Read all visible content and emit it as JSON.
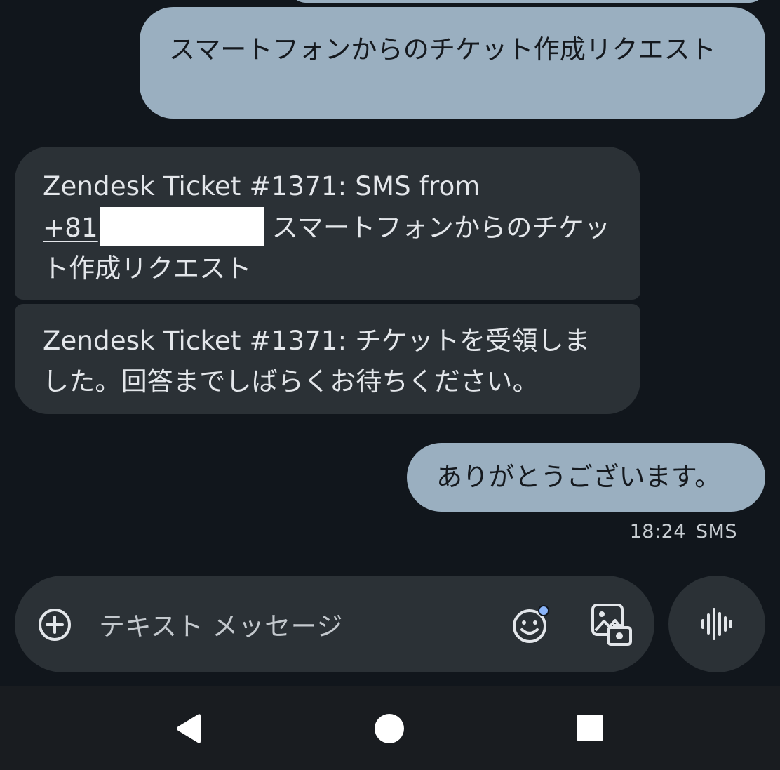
{
  "conversation": {
    "messages": [
      {
        "direction": "outgoing",
        "text": "スマートフォンからのチケット作成リクエスト"
      },
      {
        "direction": "incoming",
        "prefix": "Zendesk Ticket #1371: SMS from",
        "phone_link": "+81",
        "suffix": "スマートフォンからのチケット作成リクエスト"
      },
      {
        "direction": "incoming",
        "text": "Zendesk Ticket #1371: チケットを受領しました。回答までしばらくお待ちください。"
      },
      {
        "direction": "outgoing",
        "text": "ありがとうございます。"
      }
    ],
    "last_meta": {
      "time": "18:24",
      "channel": "SMS"
    }
  },
  "composer": {
    "placeholder": "テキスト メッセージ",
    "icons": [
      "add-circle-icon",
      "emoji-icon",
      "gallery-icon",
      "voice-waveform-icon"
    ]
  },
  "navbar": {
    "icons": [
      "back-icon",
      "home-icon",
      "recents-icon"
    ]
  },
  "colors": {
    "background": "#10151b",
    "outgoing_bubble": "#9aafc0",
    "incoming_bubble": "#2b3136",
    "emoji_badge": "#8ab4f8"
  }
}
